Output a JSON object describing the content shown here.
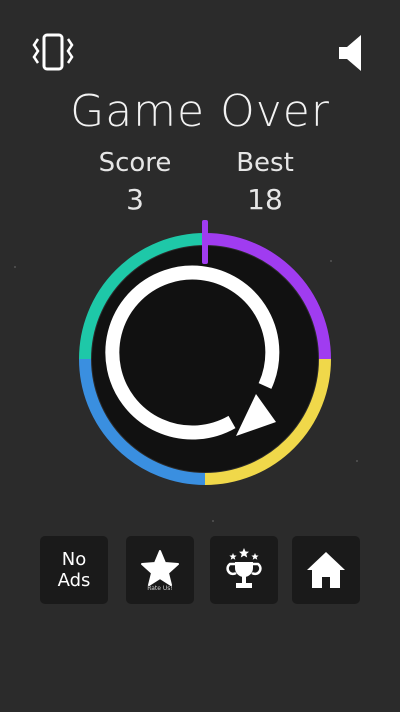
{
  "header": {
    "vibrate_icon": "vibrate-icon",
    "sound_icon": "speaker-icon"
  },
  "game_over": {
    "title": "Game Over",
    "score_label": "Score",
    "score_value": "3",
    "best_label": "Best",
    "best_value": "18"
  },
  "wheel": {
    "segments": [
      "#a03cf0",
      "#f0d84a",
      "#3a8fe0",
      "#1ec8a8"
    ],
    "replay_icon": "replay-arrow-icon",
    "indicator_color": "#a03cf0"
  },
  "buttons": {
    "no_ads_line1": "No",
    "no_ads_line2": "Ads",
    "rate_label": "Rate Us!",
    "rate_icon": "star-icon",
    "leaderboard_icon": "trophy-icon",
    "home_icon": "home-icon"
  },
  "colors": {
    "background": "#2b2b2b",
    "tile": "#1a1a1a",
    "text": "#f2f2f2"
  }
}
